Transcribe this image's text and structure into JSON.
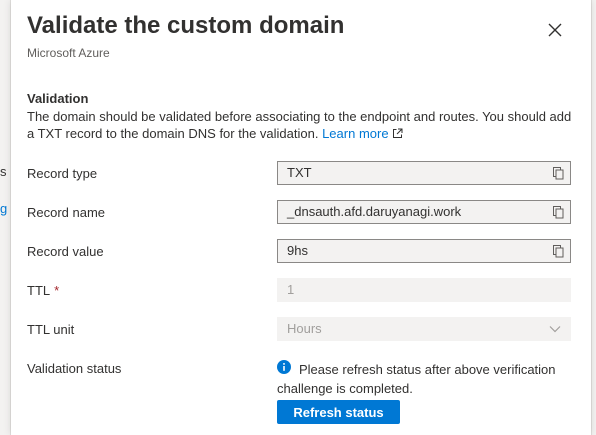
{
  "background": {
    "left_fragment_1": "s",
    "left_fragment_2": "g"
  },
  "panel": {
    "title": "Validate the custom domain",
    "subtitle": "Microsoft Azure",
    "close_icon": "close-icon"
  },
  "validation": {
    "heading": "Validation",
    "description": "The domain should be validated before associating to the endpoint and routes. You should add a TXT record to the domain DNS for the validation.",
    "learn_more": "Learn more"
  },
  "fields": {
    "record_type": {
      "label": "Record type",
      "value": "TXT"
    },
    "record_name": {
      "label": "Record name",
      "value": "_dnsauth.afd.daruyanagi.work"
    },
    "record_value": {
      "label": "Record value",
      "value": "9hs"
    },
    "ttl": {
      "label": "TTL",
      "required_mark": "*",
      "value": "1"
    },
    "ttl_unit": {
      "label": "TTL unit",
      "value": "Hours"
    },
    "validation_status": {
      "label": "Validation status",
      "message": "Please refresh status after above verification challenge is completed.",
      "refresh_button": "Refresh status"
    }
  },
  "colors": {
    "accent": "#0078d4",
    "required": "#a4262c",
    "text": "#323130",
    "muted": "#605e5c"
  }
}
